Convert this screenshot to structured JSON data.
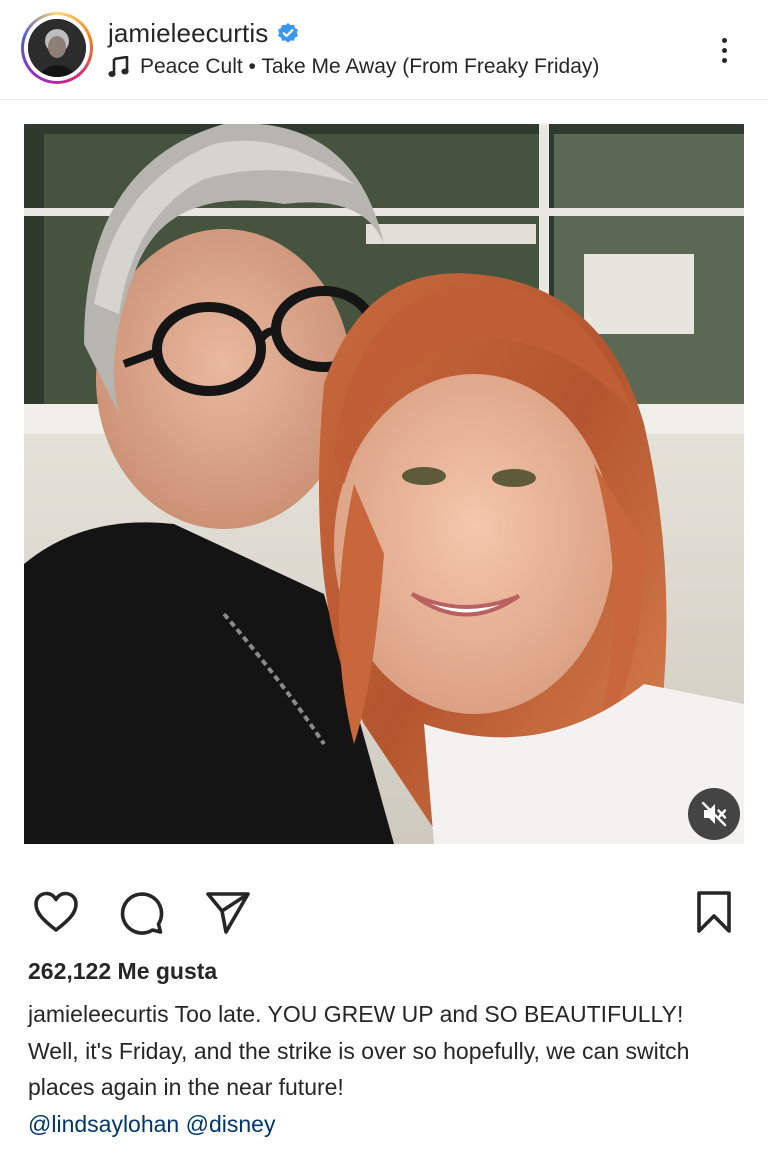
{
  "header": {
    "username": "jamieleecurtis",
    "verified_color": "#3897f0",
    "music_icon": "music-note-icon",
    "music_text": "Peace Cult • Take Me Away (From Freaky Friday)",
    "more_icon": "more-vertical-icon"
  },
  "media": {
    "mute_icon": "speaker-muted-icon"
  },
  "actions": {
    "like_icon": "heart-icon",
    "comment_icon": "comment-icon",
    "share_icon": "send-icon",
    "save_icon": "bookmark-icon"
  },
  "likes_text": "262,122 Me gusta",
  "caption": {
    "username": "jamieleecurtis",
    "text": "Too late. YOU GREW UP and SO BEAUTIFULLY! Well, it's Friday, and the strike is over so hopefully, we can switch places again in the near future!",
    "mentions": [
      "@lindsaylohan",
      "@disney"
    ]
  },
  "colors": {
    "text": "#262626",
    "link": "#00376b",
    "divider": "#ececec"
  }
}
